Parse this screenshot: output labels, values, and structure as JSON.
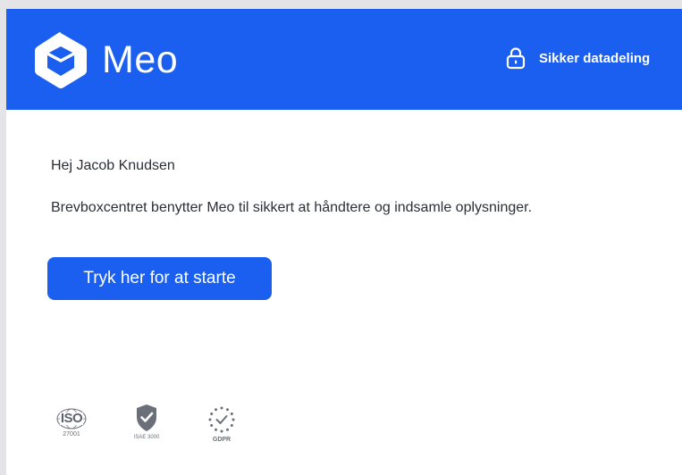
{
  "header": {
    "brand": "Meo",
    "secure_label": "Sikker datadeling",
    "background_color": "#1a5ff0"
  },
  "body": {
    "greeting": "Hej Jacob Knudsen",
    "message": "Brevboxcentret benytter Meo til sikkert at håndtere og indsamle oplysninger.",
    "cta_label": "Tryk her for at starte"
  },
  "badges": {
    "iso": {
      "title": "ISO",
      "subtitle": "27001",
      "icon": "iso-globe-icon"
    },
    "isae": {
      "title": "ISAE 3000",
      "icon": "shield-check-icon"
    },
    "gdpr": {
      "title": "GDPR",
      "icon": "eu-stars-check-icon"
    }
  },
  "icons": [
    "meo-logo-icon",
    "lock-icon"
  ]
}
